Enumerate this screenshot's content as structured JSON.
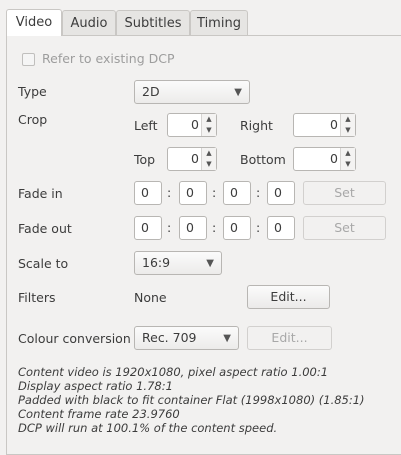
{
  "tabs": [
    {
      "label": "Video",
      "active": true
    },
    {
      "label": "Audio",
      "active": false
    },
    {
      "label": "Subtitles",
      "active": false
    },
    {
      "label": "Timing",
      "active": false
    }
  ],
  "refer_dcp": {
    "label": "Refer to existing DCP",
    "checked": false,
    "enabled": false
  },
  "type": {
    "label": "Type",
    "value": "2D"
  },
  "crop": {
    "label": "Crop",
    "left_label": "Left",
    "left": "0",
    "right_label": "Right",
    "right": "0",
    "top_label": "Top",
    "top": "0",
    "bottom_label": "Bottom",
    "bottom": "0"
  },
  "fade_in": {
    "label": "Fade in",
    "h": "0",
    "m": "0",
    "s": "0",
    "f": "0",
    "set_label": "Set"
  },
  "fade_out": {
    "label": "Fade out",
    "h": "0",
    "m": "0",
    "s": "0",
    "f": "0",
    "set_label": "Set"
  },
  "colon": ":",
  "scale": {
    "label": "Scale to",
    "value": "16:9"
  },
  "filters": {
    "label": "Filters",
    "value": "None",
    "edit_label": "Edit..."
  },
  "colour": {
    "label": "Colour conversion",
    "value": "Rec. 709",
    "edit_label": "Edit..."
  },
  "description": [
    "Content video is 1920x1080, pixel aspect ratio 1.00:1",
    "Display aspect ratio 1.78:1",
    "Padded with black to fit container Flat (1998x1080) (1.85:1)",
    "Content frame rate 23.9760",
    "DCP will run at 100.1% of the content speed."
  ],
  "icons": {
    "dropdown": "chevron-down-icon",
    "spin_up": "spin-up-icon",
    "spin_down": "spin-down-icon"
  }
}
